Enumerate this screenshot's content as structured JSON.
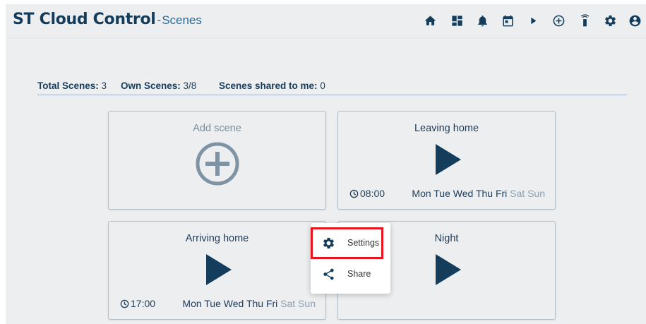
{
  "header": {
    "brand": "ST Cloud Control",
    "separator": "-",
    "subtitle": "Scenes",
    "icons": [
      "home-icon",
      "dashboard-icon",
      "bell-icon",
      "calendar-icon",
      "play-icon",
      "add-circle-icon",
      "remote-icon",
      "gear-icon",
      "account-icon"
    ]
  },
  "summary": {
    "total_label": "Total Scenes:",
    "total_value": "3",
    "own_label": "Own Scenes:",
    "own_value": "3/8",
    "shared_label": "Scenes shared to me:",
    "shared_value": "0"
  },
  "add_card": {
    "label": "Add scene",
    "icon": "add-circle-icon"
  },
  "scenes": [
    {
      "name": "Leaving home",
      "time": "08:00",
      "days_active": "Mon Tue Wed Thu Fri",
      "days_inactive": "Sat Sun"
    },
    {
      "name": "Arriving home",
      "time": "17:00",
      "days_active": "Mon Tue Wed Thu Fri",
      "days_inactive": "Sat Sun"
    },
    {
      "name": "Night"
    }
  ],
  "context_menu": {
    "items": [
      {
        "label": "Settings",
        "icon": "gear-icon",
        "highlighted": true
      },
      {
        "label": "Share",
        "icon": "share-icon"
      }
    ]
  },
  "colors": {
    "primary": "#143d5c",
    "background": "#eceef0",
    "highlight": "#e8141e",
    "muted": "#8ea0ae"
  }
}
